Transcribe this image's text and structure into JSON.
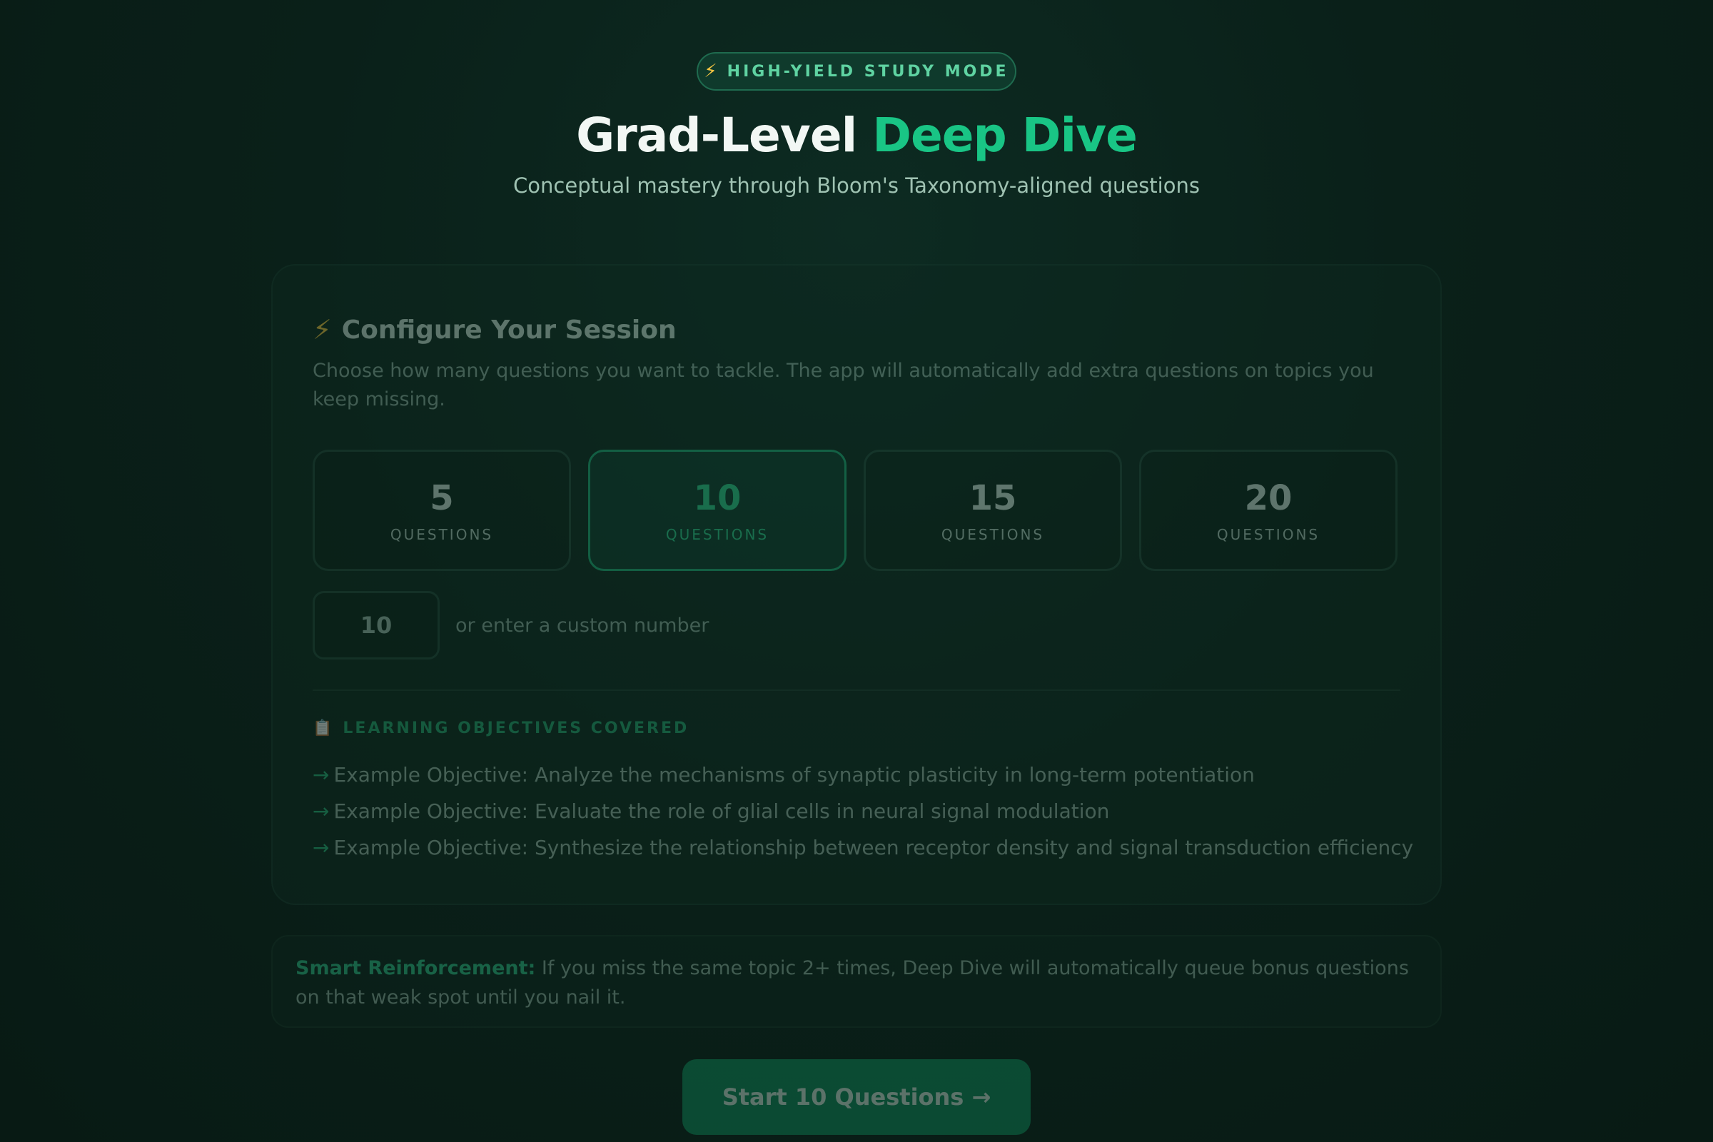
{
  "header": {
    "mode_badge_icon": "lightning-bolt-icon",
    "mode_badge_label": "HIGH-YIELD STUDY MODE",
    "title_part1": "Grad-Level",
    "title_part2": "Deep Dive",
    "subtitle": "Conceptual mastery through Bloom's Taxonomy-aligned questions"
  },
  "config": {
    "title_icon": "lightning-bolt-icon",
    "title": "Configure Your Session",
    "description": "Choose how many questions you want to tackle. The app will automatically add extra questions on topics you keep missing.",
    "options": [
      {
        "value": "5",
        "unit": "QUESTIONS",
        "selected": false
      },
      {
        "value": "10",
        "unit": "QUESTIONS",
        "selected": true
      },
      {
        "value": "15",
        "unit": "QUESTIONS",
        "selected": false
      },
      {
        "value": "20",
        "unit": "QUESTIONS",
        "selected": false
      }
    ],
    "custom_value": "10",
    "custom_label": "or enter a custom number"
  },
  "objectives": {
    "heading_icon": "clipboard-icon",
    "heading": "LEARNING OBJECTIVES COVERED",
    "arrow": "→",
    "items": [
      "Example Objective: Analyze the mechanisms of synaptic plasticity in long-term potentiation",
      "Example Objective: Evaluate the role of glial cells in neural signal modulation",
      "Example Objective: Synthesize the relationship between receptor density and signal transduction efficiency"
    ]
  },
  "reinforcement": {
    "label": "Smart Reinforcement:",
    "text": " If you miss the same topic 2+ times, Deep Dive will automatically queue bonus questions on that weak spot until you nail it."
  },
  "start_button": {
    "label": "Start 10 Questions →"
  },
  "colors": {
    "accent": "#19c585",
    "background": "#0a2019",
    "badge_bolt": "#f5c542"
  }
}
